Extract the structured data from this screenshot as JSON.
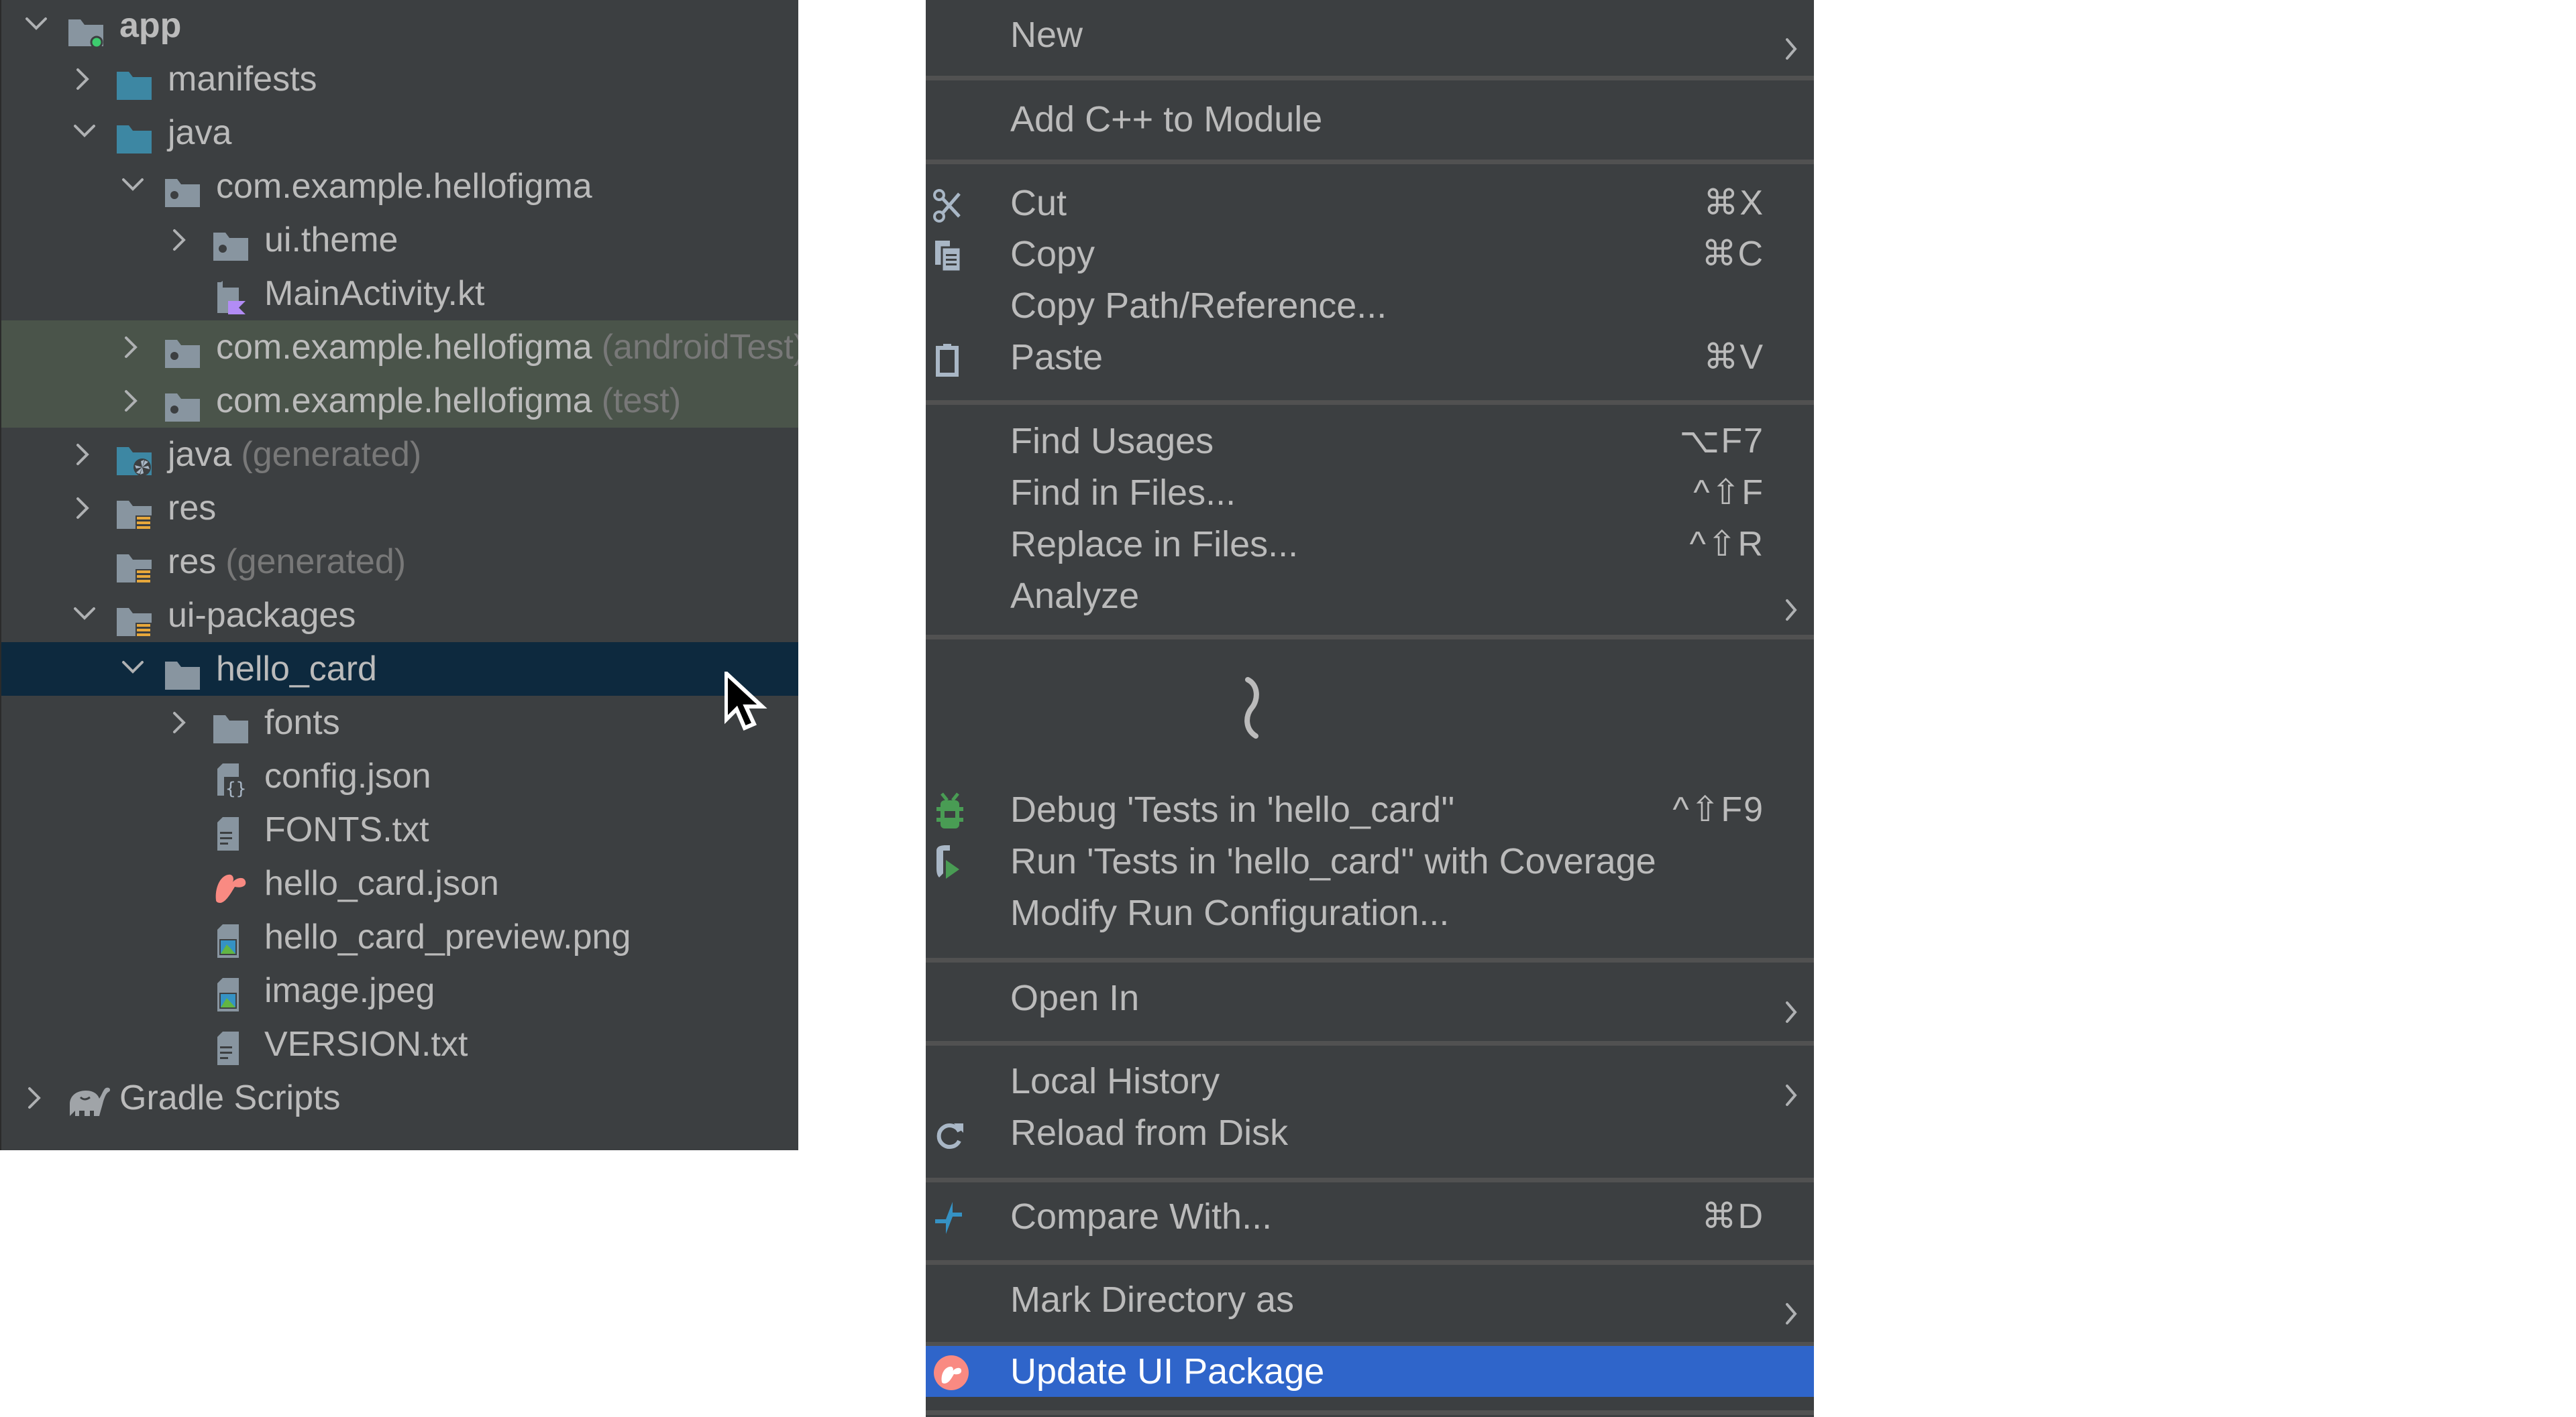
{
  "project_tree": {
    "rows": [
      {
        "label": "app",
        "hint": "",
        "depth": 0,
        "expander": "expanded",
        "icon": "module-folder-icon",
        "bold": true
      },
      {
        "label": "manifests",
        "hint": "",
        "depth": 1,
        "expander": "collapsed",
        "icon": "source-folder-icon"
      },
      {
        "label": "java",
        "hint": "",
        "depth": 1,
        "expander": "expanded",
        "icon": "source-folder-icon"
      },
      {
        "label": "com.example.hellofigma",
        "hint": "",
        "depth": 2,
        "expander": "expanded",
        "icon": "package-icon"
      },
      {
        "label": "ui.theme",
        "hint": "",
        "depth": 3,
        "expander": "collapsed",
        "icon": "package-icon"
      },
      {
        "label": "MainActivity.kt",
        "hint": "",
        "depth": 3,
        "expander": "none",
        "icon": "kotlin-file-icon"
      },
      {
        "label": "com.example.hellofigma",
        "hint": "(androidTest)",
        "depth": 2,
        "expander": "collapsed",
        "icon": "package-icon",
        "test": true
      },
      {
        "label": "com.example.hellofigma",
        "hint": "(test)",
        "depth": 2,
        "expander": "collapsed",
        "icon": "package-icon",
        "test": true
      },
      {
        "label": "java",
        "hint": "(generated)",
        "depth": 1,
        "expander": "collapsed",
        "icon": "generated-source-folder-icon"
      },
      {
        "label": "res",
        "hint": "",
        "depth": 1,
        "expander": "collapsed",
        "icon": "resource-folder-icon"
      },
      {
        "label": "res",
        "hint": "(generated)",
        "depth": 1,
        "expander": "none",
        "icon": "resource-folder-icon"
      },
      {
        "label": "ui-packages",
        "hint": "",
        "depth": 1,
        "expander": "expanded",
        "icon": "resource-folder-icon"
      },
      {
        "label": "hello_card",
        "hint": "",
        "depth": 2,
        "expander": "expanded",
        "icon": "folder-icon",
        "selected": true
      },
      {
        "label": "fonts",
        "hint": "",
        "depth": 3,
        "expander": "collapsed",
        "icon": "folder-icon"
      },
      {
        "label": "config.json",
        "hint": "",
        "depth": 3,
        "expander": "none",
        "icon": "json-file-icon"
      },
      {
        "label": "FONTS.txt",
        "hint": "",
        "depth": 3,
        "expander": "none",
        "icon": "text-file-icon"
      },
      {
        "label": "hello_card.json",
        "hint": "",
        "depth": 3,
        "expander": "none",
        "icon": "figma-relay-icon"
      },
      {
        "label": "hello_card_preview.png",
        "hint": "",
        "depth": 3,
        "expander": "none",
        "icon": "image-file-icon"
      },
      {
        "label": "image.jpeg",
        "hint": "",
        "depth": 3,
        "expander": "none",
        "icon": "image-file-icon"
      },
      {
        "label": "VERSION.txt",
        "hint": "",
        "depth": 3,
        "expander": "none",
        "icon": "text-file-icon"
      },
      {
        "label": "Gradle Scripts",
        "hint": "",
        "depth": 0,
        "expander": "collapsed",
        "icon": "gradle-elephant-icon"
      }
    ]
  },
  "context_menu": {
    "items": [
      {
        "label": "New",
        "shortcut": "",
        "submenu": true,
        "icon": ""
      },
      {
        "label": "Add C++ to Module",
        "shortcut": "",
        "submenu": false,
        "icon": ""
      },
      {
        "label": "Cut",
        "shortcut": "⌘X",
        "submenu": false,
        "icon": "scissors-icon"
      },
      {
        "label": "Copy",
        "shortcut": "⌘C",
        "submenu": false,
        "icon": "copy-icon"
      },
      {
        "label": "Copy Path/Reference...",
        "shortcut": "",
        "submenu": false,
        "icon": ""
      },
      {
        "label": "Paste",
        "shortcut": "⌘V",
        "submenu": false,
        "icon": "clipboard-icon"
      },
      {
        "label": "Find Usages",
        "shortcut": "⌥F7",
        "submenu": false,
        "icon": ""
      },
      {
        "label": "Find in Files...",
        "shortcut": "^⇧F",
        "submenu": false,
        "icon": ""
      },
      {
        "label": "Replace in Files...",
        "shortcut": "^⇧R",
        "submenu": false,
        "icon": ""
      },
      {
        "label": "Analyze",
        "shortcut": "",
        "submenu": true,
        "icon": ""
      },
      {
        "label": "Debug 'Tests in 'hello_card''",
        "shortcut": "^⇧F9",
        "submenu": false,
        "icon": "debug-bug-icon"
      },
      {
        "label": "Run 'Tests in 'hello_card'' with Coverage",
        "shortcut": "",
        "submenu": false,
        "icon": "run-coverage-icon"
      },
      {
        "label": "Modify Run Configuration...",
        "shortcut": "",
        "submenu": false,
        "icon": ""
      },
      {
        "label": "Open In",
        "shortcut": "",
        "submenu": true,
        "icon": ""
      },
      {
        "label": "Local History",
        "shortcut": "",
        "submenu": true,
        "icon": ""
      },
      {
        "label": "Reload from Disk",
        "shortcut": "",
        "submenu": false,
        "icon": "reload-icon"
      },
      {
        "label": "Compare With...",
        "shortcut": "⌘D",
        "submenu": false,
        "icon": "compare-arrows-icon"
      },
      {
        "label": "Mark Directory as",
        "shortcut": "",
        "submenu": true,
        "icon": ""
      },
      {
        "label": "Update UI Package",
        "shortcut": "",
        "submenu": false,
        "icon": "figma-relay-icon",
        "highlighted": true
      }
    ],
    "elision_marker": "omitted-items"
  },
  "colors": {
    "panel_bg": "#3c3f41",
    "text": "#bbbbbb",
    "hint_text": "#787878",
    "selection": "#0d293e",
    "test_source_row": "#4a544a",
    "menu_highlight": "#2f65ca",
    "separator": "#515151",
    "folder_blue": "#3d87a3",
    "folder_gray": "#8895a0",
    "relay_coral": "#f98a82"
  }
}
